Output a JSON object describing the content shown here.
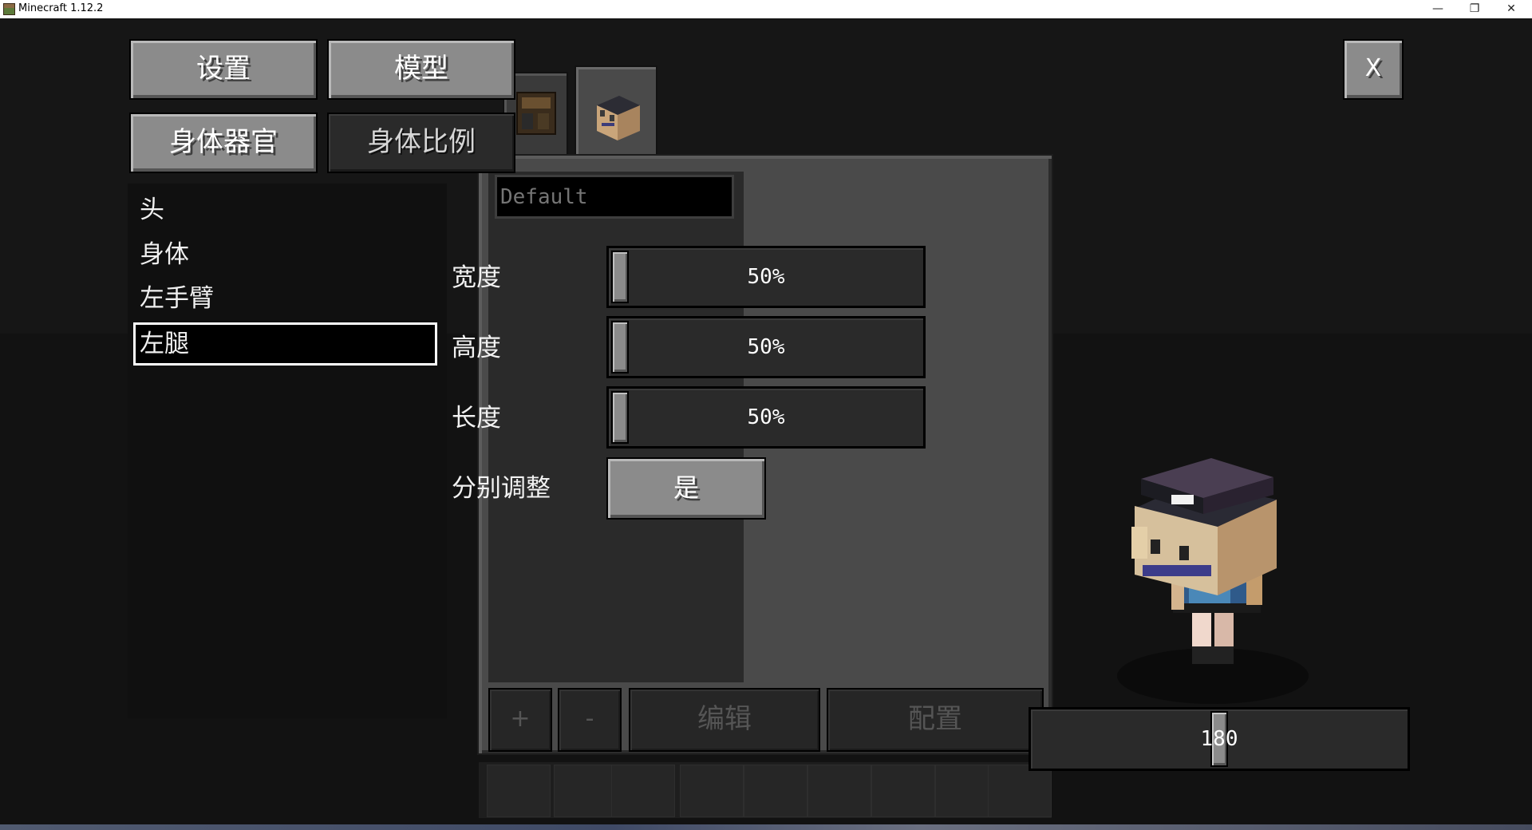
{
  "window": {
    "title": "Minecraft 1.12.2",
    "minimize": "—",
    "restore": "❐",
    "close": "✕"
  },
  "top_buttons": {
    "settings": "设置",
    "model": "模型",
    "body_parts": "身体器官",
    "body_scale": "身体比例",
    "close": "X"
  },
  "tabs": [
    {
      "icon": "crafting-table-icon"
    },
    {
      "icon": "player-head-icon",
      "active": true
    }
  ],
  "preset_field": {
    "placeholder": "Default"
  },
  "body_list": {
    "items": [
      "头",
      "身体",
      "左手臂",
      "左腿"
    ],
    "selected": "左腿"
  },
  "sliders": [
    {
      "label": "宽度",
      "value": "50%"
    },
    {
      "label": "高度",
      "value": "50%"
    },
    {
      "label": "长度",
      "value": "50%"
    }
  ],
  "separate": {
    "label": "分别调整",
    "value": "是"
  },
  "bottom_buttons": {
    "add": "+",
    "remove": "-",
    "edit": "编辑",
    "config": "配置"
  },
  "rotation": {
    "value": "180"
  }
}
